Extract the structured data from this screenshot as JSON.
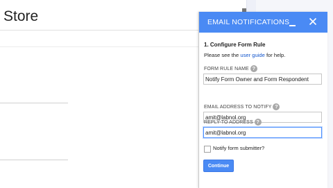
{
  "background_app": {
    "title": "Store"
  },
  "panel": {
    "title": "EMAIL NOTIFICATIONS",
    "minimize_icon": "minimize-icon",
    "close_icon": "close-icon",
    "section_title": "1. Configure Form Rule",
    "guide_prefix": "Please see the ",
    "guide_link": "user guide",
    "guide_suffix": " for help.",
    "fields": [
      {
        "label": "FORM RULE NAME",
        "value": "Notify Form Owner and Form Respondent",
        "help_icon": "?"
      },
      {
        "label": "EMAIL ADDRESS TO NOTIFY",
        "value": "amit@labnol.org",
        "help_icon": "?"
      },
      {
        "label": "REPLY-TO ADDRESS",
        "value": "amit@labnol.org",
        "help_icon": "?"
      }
    ],
    "checkbox_label": "Notify form submitter?",
    "checkbox_checked": false,
    "continue_label": "Continue",
    "accent_color": "#4a8af4",
    "link_color": "#1155cc"
  }
}
